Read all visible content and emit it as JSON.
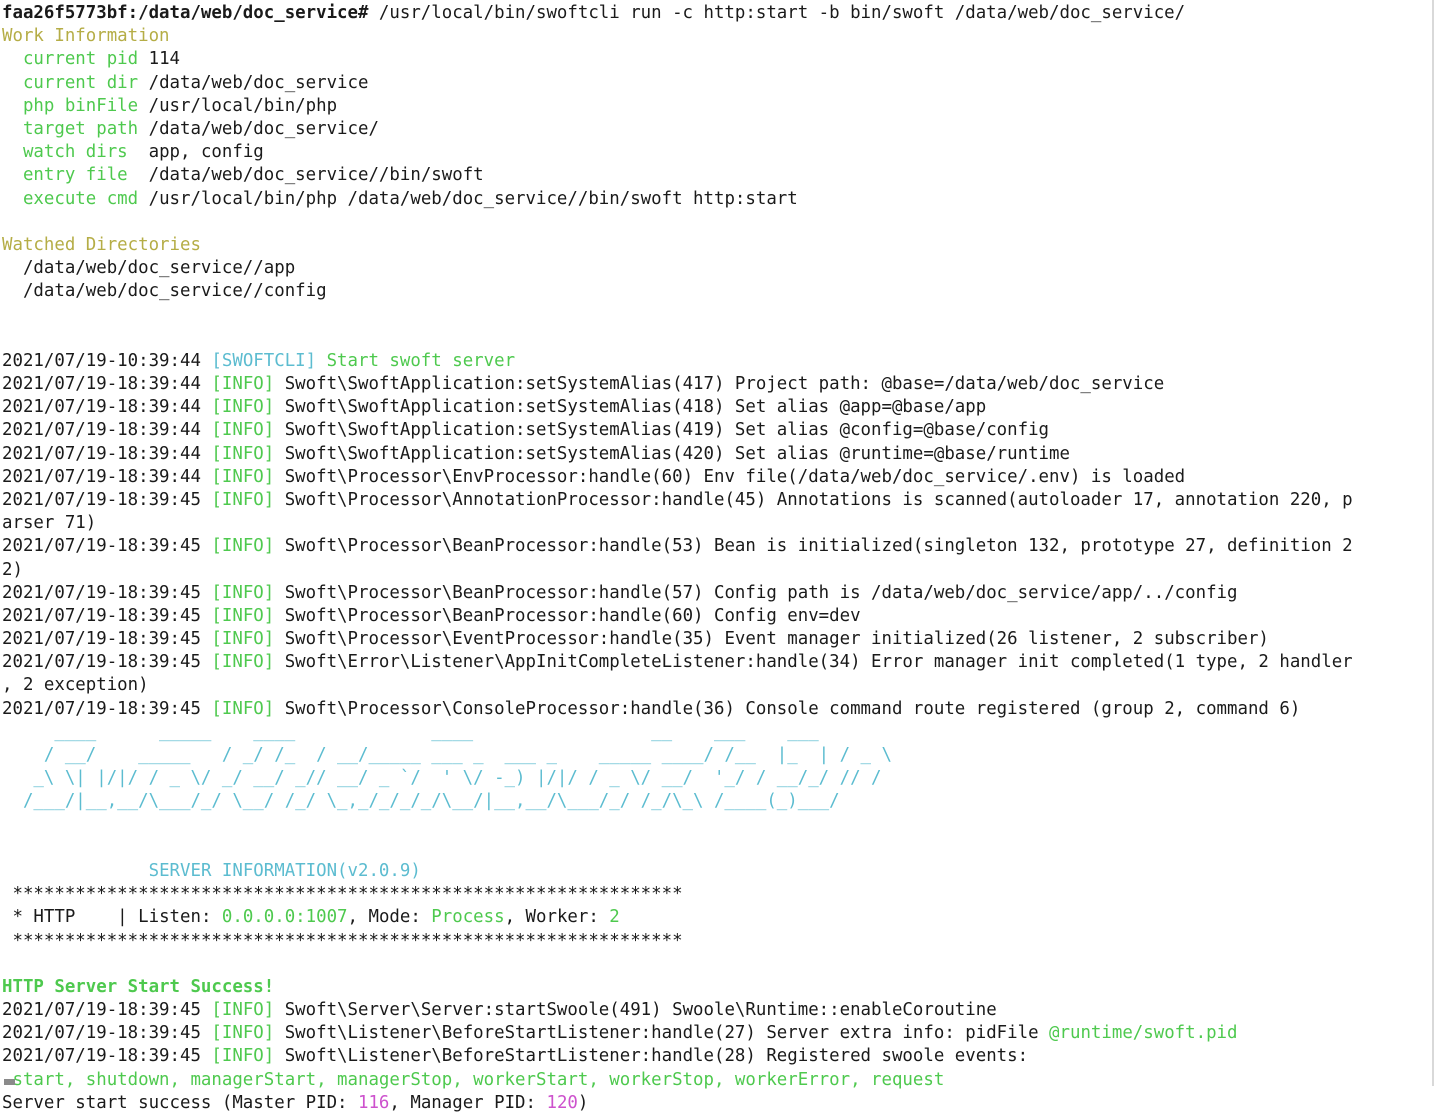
{
  "terminal": {
    "colors": {
      "background": "#ffffff",
      "foreground": "#1a1a1a",
      "green": "#4ec94e",
      "olive": "#b5ad46",
      "cyan": "#5cbcd0",
      "magenta": "#cd52cd",
      "cursor": "#8a8a8a"
    },
    "prompt": {
      "host_path": "faa26f5773bf:/data/web/doc_service#",
      "command": " /usr/local/bin/swoftcli run -c http:start -b bin/swoft /data/web/doc_service/"
    },
    "work_information": {
      "heading": "Work Information",
      "rows": [
        {
          "label": "  current pid ",
          "value": "114"
        },
        {
          "label": "  current dir ",
          "value": "/data/web/doc_service"
        },
        {
          "label": "  php binFile ",
          "value": "/usr/local/bin/php"
        },
        {
          "label": "  target path ",
          "value": "/data/web/doc_service/"
        },
        {
          "label": "  watch dirs  ",
          "value": "app, config"
        },
        {
          "label": "  entry file  ",
          "value": "/data/web/doc_service//bin/swoft"
        },
        {
          "label": "  execute cmd ",
          "value": "/usr/local/bin/php /data/web/doc_service//bin/swoft http:start"
        }
      ]
    },
    "watched_directories": {
      "heading": "Watched Directories",
      "paths": [
        "  /data/web/doc_service//app",
        "  /data/web/doc_service//config"
      ]
    },
    "log_lines": [
      {
        "timestamp": "2021/07/19-10:39:44 ",
        "tag": "[SWOFTCLI]",
        "tag_color": "cyan",
        "message": " Start swoft server",
        "message_color": "green"
      },
      {
        "timestamp": "2021/07/19-18:39:44 ",
        "tag": "[INFO]",
        "tag_color": "green",
        "message": " Swoft\\SwoftApplication:setSystemAlias(417) Project path: @base=/data/web/doc_service",
        "message_color": "default"
      },
      {
        "timestamp": "2021/07/19-18:39:44 ",
        "tag": "[INFO]",
        "tag_color": "green",
        "message": " Swoft\\SwoftApplication:setSystemAlias(418) Set alias @app=@base/app",
        "message_color": "default"
      },
      {
        "timestamp": "2021/07/19-18:39:44 ",
        "tag": "[INFO]",
        "tag_color": "green",
        "message": " Swoft\\SwoftApplication:setSystemAlias(419) Set alias @config=@base/config",
        "message_color": "default"
      },
      {
        "timestamp": "2021/07/19-18:39:44 ",
        "tag": "[INFO]",
        "tag_color": "green",
        "message": " Swoft\\SwoftApplication:setSystemAlias(420) Set alias @runtime=@base/runtime",
        "message_color": "default"
      },
      {
        "timestamp": "2021/07/19-18:39:44 ",
        "tag": "[INFO]",
        "tag_color": "green",
        "message": " Swoft\\Processor\\EnvProcessor:handle(60) Env file(/data/web/doc_service/.env) is loaded",
        "message_color": "default"
      },
      {
        "timestamp": "2021/07/19-18:39:45 ",
        "tag": "[INFO]",
        "tag_color": "green",
        "message": " Swoft\\Processor\\AnnotationProcessor:handle(45) Annotations is scanned(autoloader 17, annotation 220, parser 71)",
        "message_color": "default"
      },
      {
        "timestamp": "2021/07/19-18:39:45 ",
        "tag": "[INFO]",
        "tag_color": "green",
        "message": " Swoft\\Processor\\BeanProcessor:handle(53) Bean is initialized(singleton 132, prototype 27, definition 22)",
        "message_color": "default"
      },
      {
        "timestamp": "2021/07/19-18:39:45 ",
        "tag": "[INFO]",
        "tag_color": "green",
        "message": " Swoft\\Processor\\BeanProcessor:handle(57) Config path is /data/web/doc_service/app/../config",
        "message_color": "default"
      },
      {
        "timestamp": "2021/07/19-18:39:45 ",
        "tag": "[INFO]",
        "tag_color": "green",
        "message": " Swoft\\Processor\\BeanProcessor:handle(60) Config env=dev",
        "message_color": "default"
      },
      {
        "timestamp": "2021/07/19-18:39:45 ",
        "tag": "[INFO]",
        "tag_color": "green",
        "message": " Swoft\\Processor\\EventProcessor:handle(35) Event manager initialized(26 listener, 2 subscriber)",
        "message_color": "default"
      },
      {
        "timestamp": "2021/07/19-18:39:45 ",
        "tag": "[INFO]",
        "tag_color": "green",
        "message": " Swoft\\Error\\Listener\\AppInitCompleteListener:handle(34) Error manager init completed(1 type, 2 handler, 2 exception)",
        "message_color": "default"
      },
      {
        "timestamp": "2021/07/19-18:39:45 ",
        "tag": "[INFO]",
        "tag_color": "green",
        "message": " Swoft\\Processor\\ConsoleProcessor:handle(36) Console command route registered (group 2, command 6)",
        "message_color": "default"
      }
    ],
    "ascii_art": [
      "     ____      _____    ____             ____                 __    ___    ___",
      "    / __/    _____   / _/ /_  / __/_____ ___ _  ___ _    _____ ____/ /__  |_  | / _ \\",
      "   _\\ \\| |/|/ / _ \\/ _/ __/ _// __/ _ `/  ' \\/ -_) |/|/ / _ \\/ __/  '_/ / __/_/ // /",
      "  /___/|__,__/\\___/_/ \\__/ /_/ \\_,_/_/_/_/\\__/|__,__/\\___/_/ /_/\\_\\ /____(_)___/"
    ],
    "server_information": {
      "title": "SERVER INFORMATION(v2.0.9)",
      "divider": "****************************************************************",
      "row": {
        "prefix": "* HTTP    | Listen: ",
        "listen": "0.0.0.0:1007",
        "mid": ", Mode: ",
        "mode": "Process",
        "suffix": ", Worker: ",
        "worker": "2"
      }
    },
    "success_banner": "HTTP Server Start Success!",
    "tail_lines": [
      {
        "timestamp": "2021/07/19-18:39:45 ",
        "tag": "[INFO]",
        "message": " Swoft\\Server\\Server:startSwoole(491) Swoole\\Runtime::enableCoroutine"
      },
      {
        "timestamp": "2021/07/19-18:39:45 ",
        "tag": "[INFO]",
        "message": " Swoft\\Listener\\BeforeStartListener:handle(27) Server extra info: pidFile ",
        "highlight": "@runtime/swoft.pid"
      },
      {
        "timestamp": "2021/07/19-18:39:45 ",
        "tag": "[INFO]",
        "message": " Swoft\\Listener\\BeforeStartListener:handle(28) Registered swoole events:"
      }
    ],
    "events_line": " start, shutdown, managerStart, managerStop, workerStart, workerStop, workerError, request",
    "final_line": {
      "prefix": "Server start success (Master PID: ",
      "master_pid": "116",
      "mid": ", Manager PID: ",
      "manager_pid": "120",
      "suffix": ")"
    }
  }
}
